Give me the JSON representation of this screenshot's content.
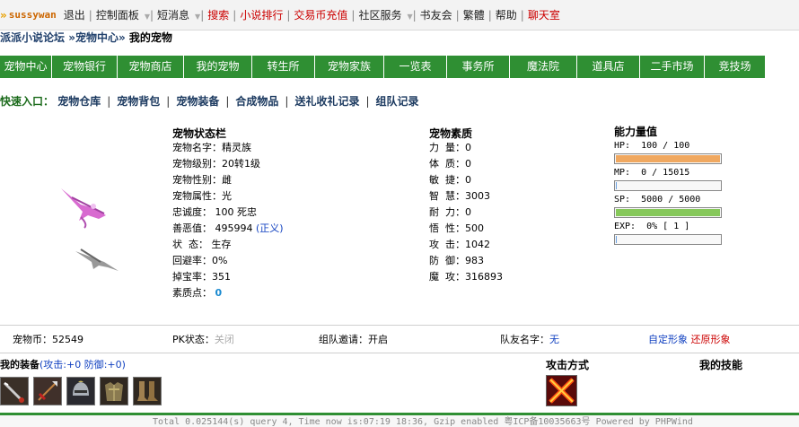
{
  "topbar": {
    "arrow": "»",
    "username": "sussywan",
    "links": [
      {
        "label": "退出",
        "red": false,
        "caret": false
      },
      {
        "label": "控制面板",
        "red": false,
        "caret": true
      },
      {
        "label": "短消息",
        "red": false,
        "caret": true
      },
      {
        "label": "搜索",
        "red": true,
        "caret": false
      },
      {
        "label": "小说排行",
        "red": true,
        "caret": false
      },
      {
        "label": "交易币充值",
        "red": true,
        "caret": false
      },
      {
        "label": "社区服务",
        "red": false,
        "caret": true
      },
      {
        "label": "书友会",
        "red": false,
        "caret": false
      },
      {
        "label": "繁體",
        "red": false,
        "caret": false
      },
      {
        "label": "帮助",
        "red": false,
        "caret": false
      },
      {
        "label": "聊天室",
        "red": true,
        "caret": false
      }
    ]
  },
  "breadcrumb": {
    "forum": "派派小说论坛",
    "sep1": " »",
    "center": "宠物中心",
    "sep2": "» ",
    "current": "我的宠物"
  },
  "nav": {
    "tabs": [
      "宠物中心",
      "宠物银行",
      "宠物商店",
      "我的宠物",
      "转生所",
      "宠物家族",
      "一览表",
      "事务所",
      "魔法院",
      "道具店",
      "二手市场",
      "竞技场"
    ]
  },
  "quick": {
    "label": "快速入口：",
    "links": [
      "宠物仓库",
      "宠物背包",
      "宠物装备",
      "合成物品",
      "送礼收礼记录",
      "组队记录"
    ]
  },
  "status_panel": {
    "title": "宠物状态栏",
    "name_label": "宠物名字：",
    "name": "精灵族",
    "level_label": "宠物级别：",
    "level": "20转1级",
    "gender_label": "宠物性别：",
    "gender": "雌",
    "attr_label": "宠物属性：",
    "attr": "光",
    "loyalty_label": "忠诚度： ",
    "loyalty": "100 死忠",
    "karma_label": "善恶值： ",
    "karma": "495994",
    "karma_tag": "(正义)",
    "state_label": "状  态： ",
    "state": "生存",
    "evade_label": "回避率：",
    "evade": "0%",
    "treasure_label": "掉宝率：",
    "treasure": "351",
    "points_label": "素质点： ",
    "points": "0"
  },
  "quality_panel": {
    "title": "宠物素质",
    "rows": [
      {
        "label": "力  量：",
        "value": "0"
      },
      {
        "label": "体  质：",
        "value": "0"
      },
      {
        "label": "敏  捷：",
        "value": "0"
      },
      {
        "label": "智  慧：",
        "value": "3003"
      },
      {
        "label": "耐  力：",
        "value": "0"
      },
      {
        "label": "悟  性：",
        "value": "500"
      },
      {
        "label": "攻  击：",
        "value": "1042"
      },
      {
        "label": "防  御：",
        "value": "983"
      },
      {
        "label": "魔  攻：",
        "value": "316893"
      }
    ]
  },
  "ability": {
    "title": "能力量值",
    "hp_text": "HP:  100 / 100",
    "mp_text": "MP:  0 / 15015",
    "sp_text": "SP:  5000 / 5000",
    "exp_text": "EXP:  0% [ 1 ]",
    "hp_fill": 1.0,
    "mp_fill": 0.0,
    "sp_fill": 1.0,
    "exp_fill": 0.0,
    "colors": {
      "hp": "#f0a860",
      "mp": "#6aa0e0",
      "sp": "#86c85a",
      "exp": "#6aa0e0"
    }
  },
  "statusbar": {
    "coins_label": "宠物币：",
    "coins": "52549",
    "pk_label": "PK状态：",
    "pk": "关闭",
    "team_label": "组队邀请：",
    "team": "开启",
    "mate_label": "队友名字：",
    "mate": "无",
    "custom_look": "自定形象",
    "restore_look": "还原形象"
  },
  "equipment": {
    "title": "我的装备",
    "stats": "(攻击:+0 防御:+0)",
    "items": [
      "sword-icon",
      "spear-icon",
      "helmet-icon",
      "armor-icon",
      "boots-icon"
    ]
  },
  "attack": {
    "title": "攻击方式",
    "icon": "fire-cross-icon"
  },
  "skills": {
    "title": "我的技能"
  },
  "footer": {
    "text": "Total 0.025144(s) query 4, Time now is:07:19 18:36, Gzip enabled 粤ICP备10035663号 Powered by PHPWind"
  }
}
